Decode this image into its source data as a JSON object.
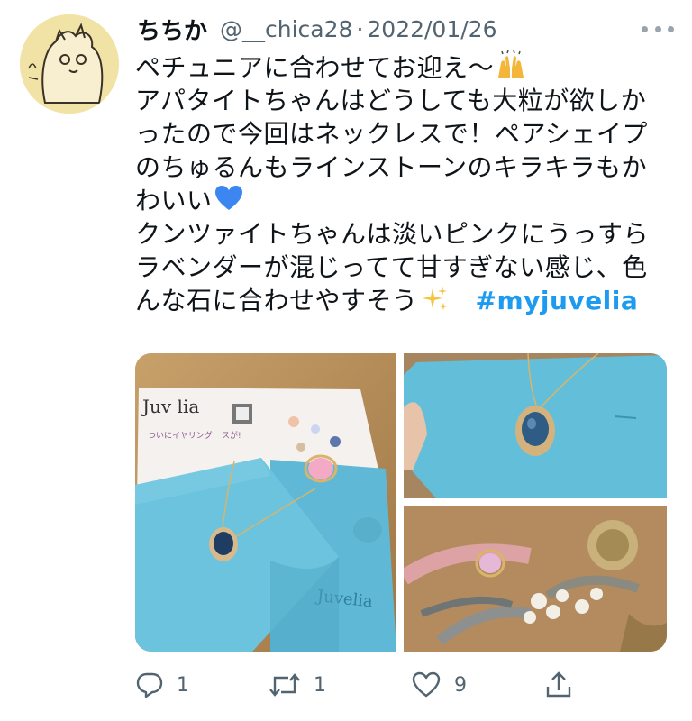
{
  "tweet": {
    "display_name": "ちちか",
    "handle": "@__chica28",
    "separator": "·",
    "date": "2022/01/26",
    "lines": [
      "ペチュニアに合わせてお迎え〜",
      "アパタイトちゃんはどうしても大粒が欲しか",
      "ったので今回はネックレスで！ペアシェイプ",
      "のちゅるんもラインストーンのキラキラもか",
      "わいい",
      "クンツァイトちゃんは淡いピンクにうっすら",
      "ラベンダーが混じってて甘すぎない感じ、色",
      "んな石に合わせやすそう"
    ],
    "hashtag": "#myjuvelia",
    "icons": {
      "line1": "raising-hands-emoji",
      "line5": "blue-heart-emoji",
      "line8": "sparkles-emoji"
    }
  },
  "media": {
    "photo1_text": "Juvelia",
    "photo1_card_title": "Juv lia",
    "photo1_card_small_1": "ついにイヤリング",
    "photo1_card_small_2": "スが!"
  },
  "actions": {
    "reply_count": "1",
    "retweet_count": "1",
    "like_count": "9",
    "icons": [
      "reply-icon",
      "retweet-icon",
      "like-icon",
      "share-icon"
    ]
  },
  "colors": {
    "link": "#1d9bf0",
    "secondary_text": "#536471",
    "pouch_blue": "#5fb9d6"
  }
}
